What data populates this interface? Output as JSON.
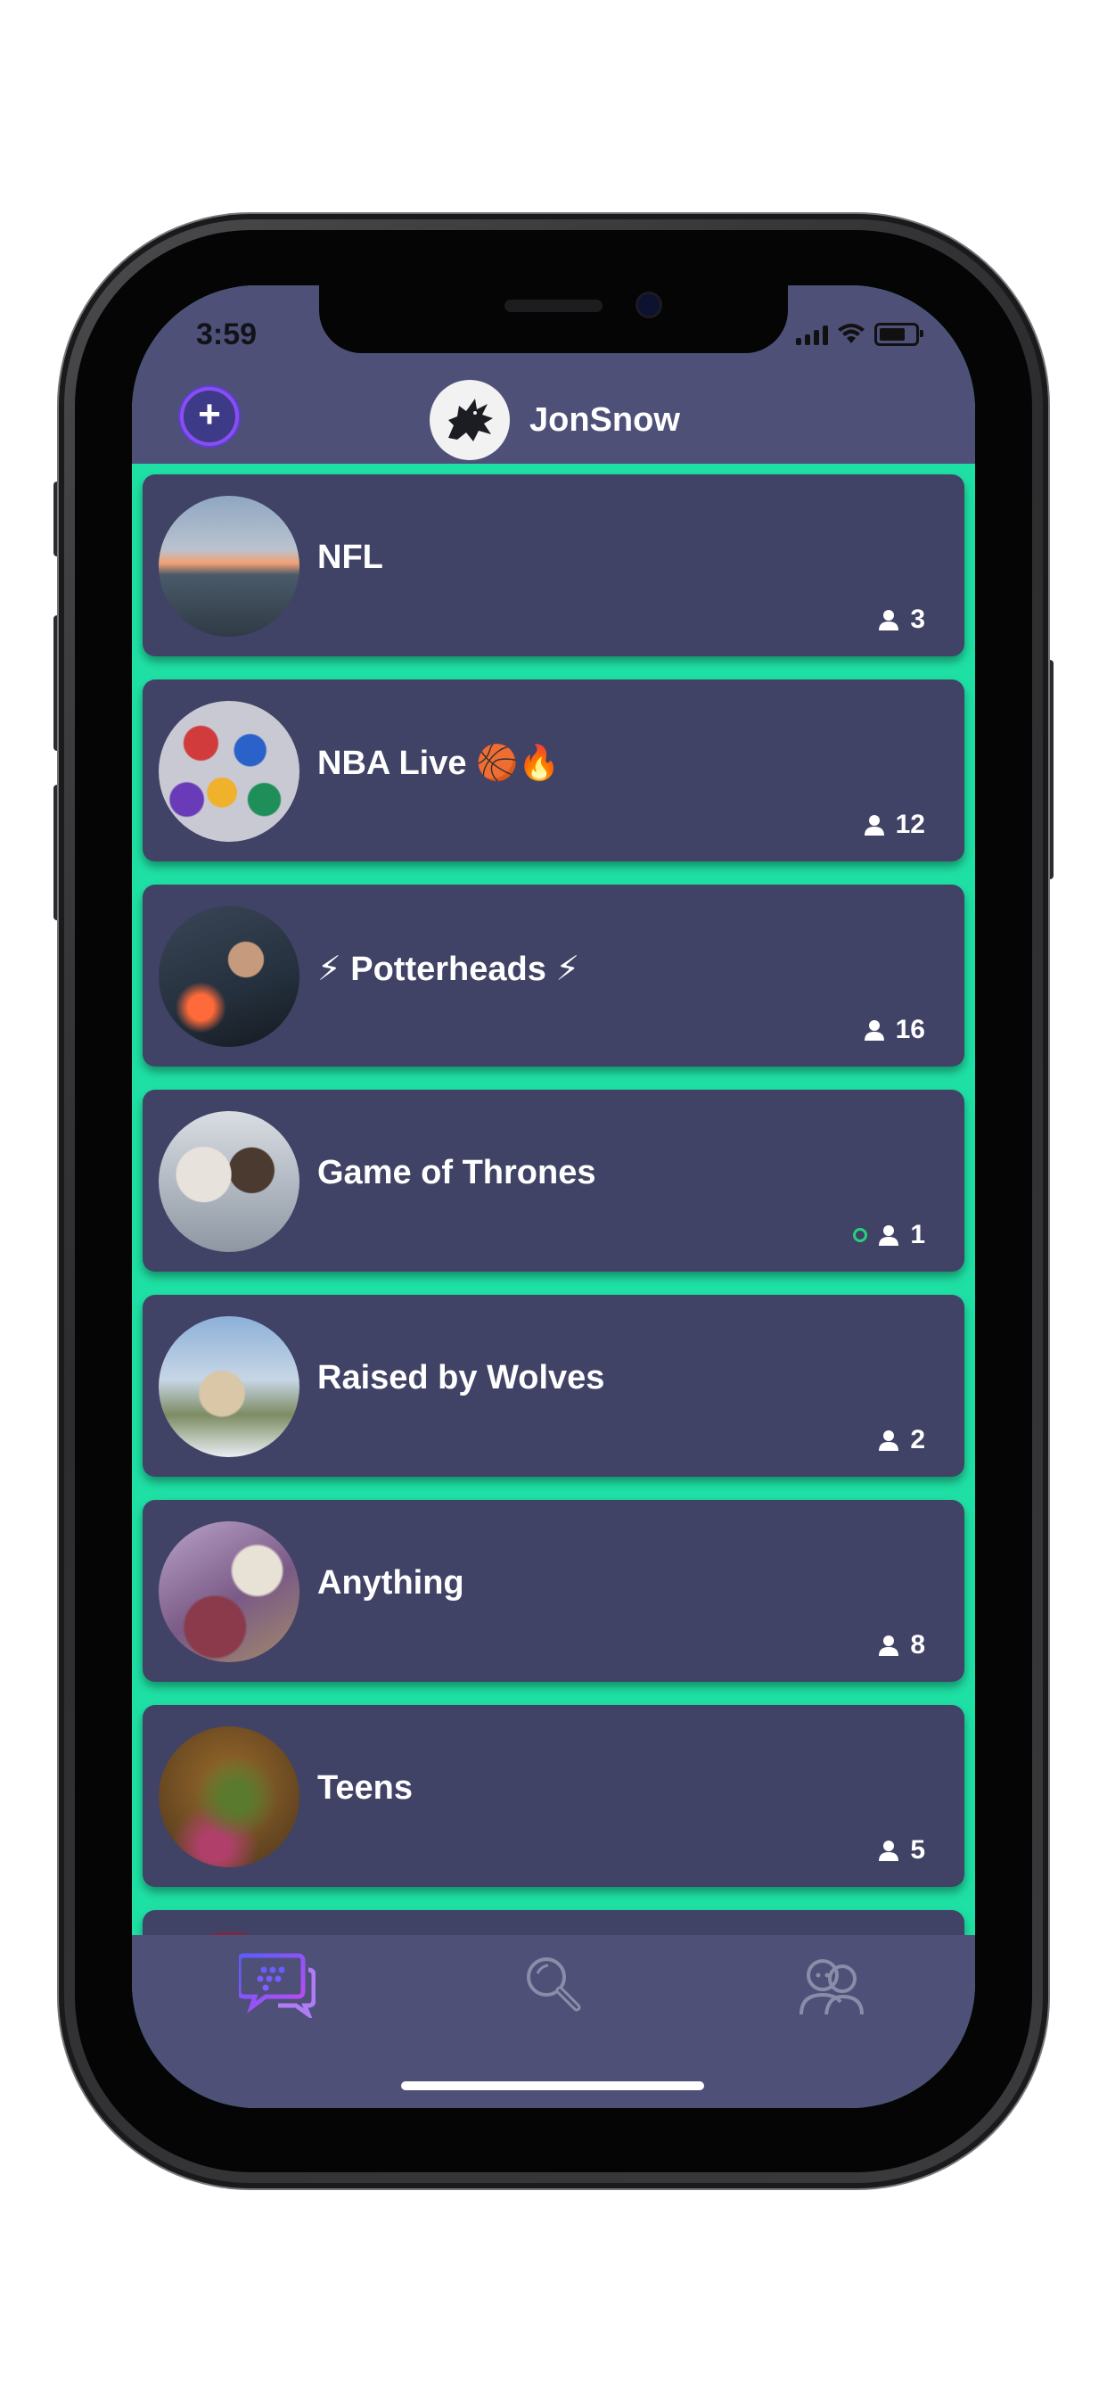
{
  "status_bar": {
    "time": "3:59"
  },
  "header": {
    "add_label": "+",
    "username": "JonSnow"
  },
  "rooms": [
    {
      "name": "NFL",
      "members": "3",
      "online": false
    },
    {
      "name": "NBA Live 🏀🔥",
      "members": "12",
      "online": false
    },
    {
      "name": "⚡ Potterheads ⚡",
      "members": "16",
      "online": false
    },
    {
      "name": "Game of Thrones",
      "members": "1",
      "online": true
    },
    {
      "name": "Raised by Wolves",
      "members": "2",
      "online": false
    },
    {
      "name": "Anything",
      "members": "8",
      "online": false
    },
    {
      "name": "Teens",
      "members": "5",
      "online": false
    }
  ],
  "tabs": [
    {
      "icon": "chat-bubbles-icon",
      "active": true
    },
    {
      "icon": "search-icon",
      "active": false
    },
    {
      "icon": "friends-icon",
      "active": false
    }
  ],
  "colors": {
    "background": "#1fe0a4",
    "bar": "#4e5078",
    "card": "#404266",
    "accent": "#8a4df2",
    "online": "#26d07c"
  }
}
